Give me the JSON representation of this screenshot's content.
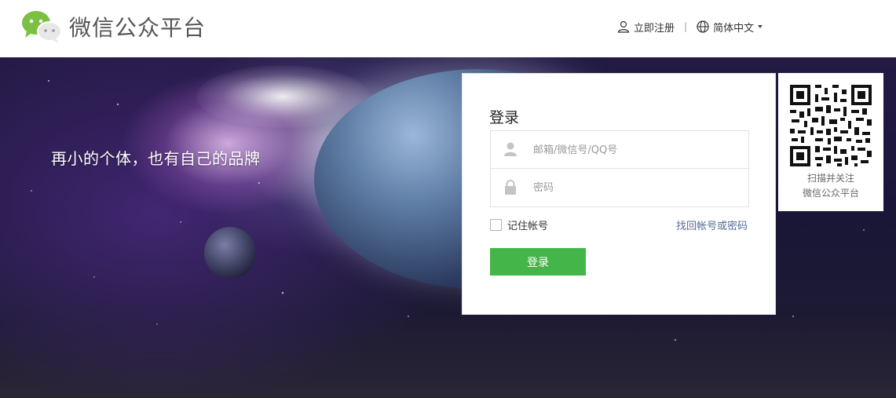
{
  "header": {
    "brand": "微信公众平台",
    "register_label": "立即注册",
    "separator": "|",
    "language_label": "简体中文"
  },
  "banner": {
    "tagline": "再小的个体，也有自己的品牌"
  },
  "login": {
    "title": "登录",
    "account_placeholder": "邮箱/微信号/QQ号",
    "password_placeholder": "密码",
    "remember_label": "记住帐号",
    "forgot_link": "找回帐号或密码",
    "submit_label": "登录"
  },
  "qr": {
    "line1": "扫描并关注",
    "line2": "微信公众平台"
  },
  "colors": {
    "primary_button": "#44b549",
    "link": "#576b95",
    "logo_green": "#7bc043"
  },
  "icons": {
    "logo": "wechat-logo-icon",
    "register": "user-icon",
    "language": "globe-icon",
    "account": "user-icon",
    "password": "lock-icon"
  }
}
